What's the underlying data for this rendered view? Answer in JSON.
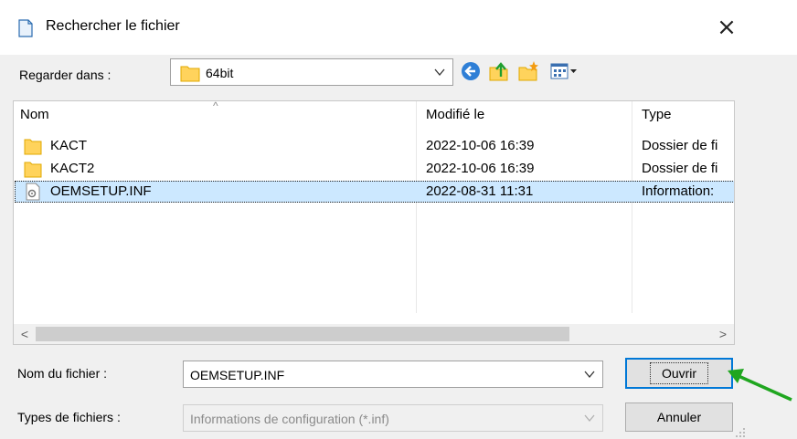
{
  "dialog": {
    "title": "Rechercher le fichier"
  },
  "look_in": {
    "label": "Regarder dans :",
    "value": "64bit"
  },
  "columns": {
    "name": "Nom",
    "modified": "Modifié le",
    "type": "Type"
  },
  "files": [
    {
      "name": "KACT",
      "modified": "2022-10-06 16:39",
      "type": "Dossier de fi",
      "icon": "folder-icon",
      "selected": false
    },
    {
      "name": "KACT2",
      "modified": "2022-10-06 16:39",
      "type": "Dossier de fi",
      "icon": "folder-icon",
      "selected": false
    },
    {
      "name": "OEMSETUP.INF",
      "modified": "2022-08-31 11:31",
      "type": "Information:",
      "icon": "inf-file-icon",
      "selected": true
    }
  ],
  "filename": {
    "label": "Nom du fichier :",
    "value": "OEMSETUP.INF"
  },
  "filetype": {
    "label": "Types de fichiers :",
    "value": "Informations de configuration (*.inf)"
  },
  "buttons": {
    "open": "Ouvrir",
    "cancel": "Annuler"
  },
  "colors": {
    "accent": "#0078d7",
    "selection": "#cce8ff",
    "arrow": "#1fa61f",
    "folder": "#ffd35c"
  }
}
